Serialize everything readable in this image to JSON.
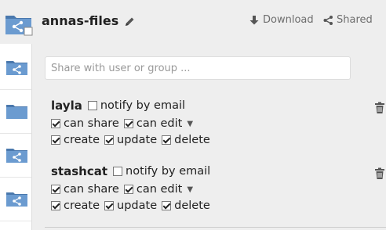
{
  "header": {
    "title": "annas-files",
    "download_label": "Download",
    "shared_label": "Shared"
  },
  "share_input": {
    "placeholder": "Share with user or group ...",
    "value": ""
  },
  "shares": [
    {
      "user": "layla",
      "notify_label": "notify by email",
      "notify_checked": false,
      "can_share_label": "can share",
      "can_edit_label": "can edit",
      "create_label": "create",
      "update_label": "update",
      "delete_label": "delete"
    },
    {
      "user": "stashcat",
      "notify_label": "notify by email",
      "notify_checked": false,
      "can_share_label": "can share",
      "can_edit_label": "can edit",
      "create_label": "create",
      "update_label": "update",
      "delete_label": "delete"
    }
  ],
  "colors": {
    "folder_blue": "#5b8cc4",
    "panel_bg": "#eeeeee",
    "muted_text": "#6d6d6d"
  },
  "icons": [
    "shared-folder-icon",
    "folder-icon",
    "pencil-icon",
    "download-icon",
    "share-icon",
    "trash-icon",
    "caret-down-icon"
  ]
}
